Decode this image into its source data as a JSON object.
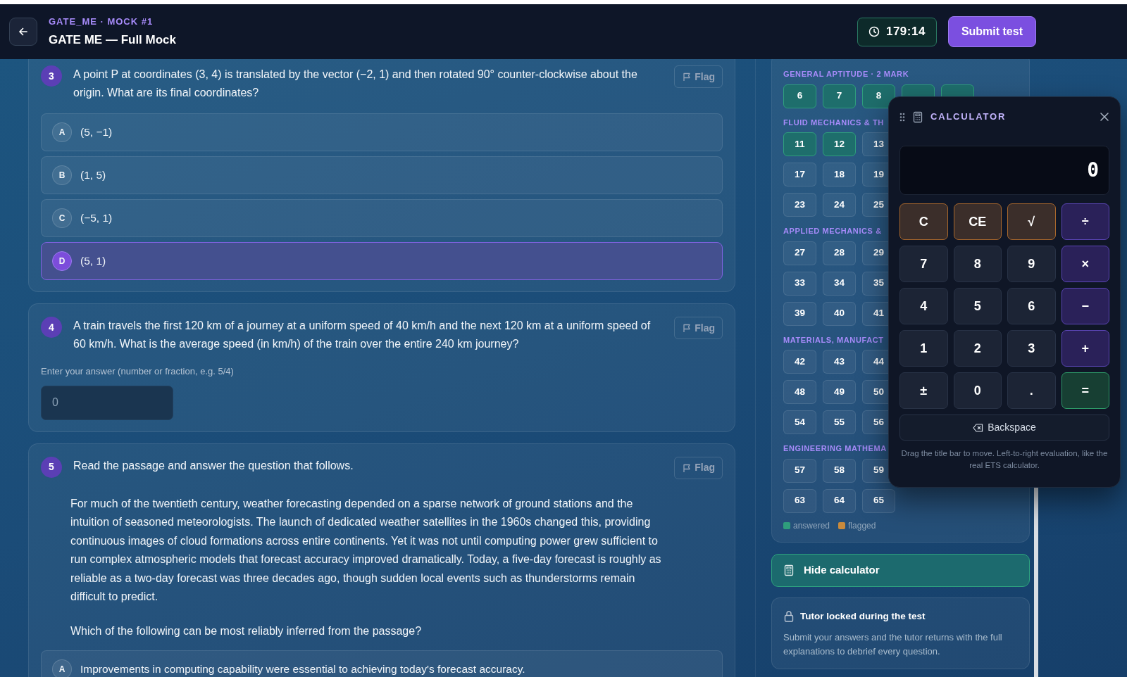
{
  "header": {
    "eyebrow": "GATE_ME · MOCK #1",
    "title": "GATE ME — Full Mock",
    "timer": "179:14",
    "submit": "Submit test"
  },
  "questions": [
    {
      "number": "3",
      "kind": "mcq",
      "prompt": "A point P at coordinates (3, 4) is translated by the vector (−2, 1) and then rotated 90° counter-clockwise about the origin. What are its final coordinates?",
      "flag": "Flag",
      "options": [
        {
          "letter": "A",
          "text": "(5, −1)",
          "selected": false
        },
        {
          "letter": "B",
          "text": "(1, 5)",
          "selected": false
        },
        {
          "letter": "C",
          "text": "(−5, 1)",
          "selected": false
        },
        {
          "letter": "D",
          "text": "(5, 1)",
          "selected": true
        }
      ]
    },
    {
      "number": "4",
      "kind": "numeric",
      "prompt": "A train travels the first 120 km of a journey at a uniform speed of 40 km/h and the next 120 km at a uniform speed of 60 km/h. What is the average speed (in km/h) of the train over the entire 240 km journey?",
      "flag": "Flag",
      "answer_label": "Enter your answer (number or fraction, e.g. 5/4)",
      "placeholder": "0"
    },
    {
      "number": "5",
      "kind": "passage",
      "prompt": "Read the passage and answer the question that follows.",
      "flag": "Flag",
      "passage": "For much of the twentieth century, weather forecasting depended on a sparse network of ground stations and the intuition of seasoned meteorologists. The launch of dedicated weather satellites in the 1960s changed this, providing continuous images of cloud formations across entire continents. Yet it was not until computing power grew sufficient to run complex atmospheric models that forecast accuracy improved dramatically. Today, a five-day forecast is roughly as reliable as a two-day forecast was three decades ago, though sudden local events such as thunderstorms remain difficult to predict.",
      "question": "Which of the following can be most reliably inferred from the passage?",
      "options": [
        {
          "letter": "A",
          "text": "Improvements in computing capability were essential to achieving today's forecast accuracy.",
          "selected": false
        }
      ]
    }
  ],
  "palette": {
    "sections": [
      {
        "title": "GENERAL APTITUDE · 2 MARK",
        "rows": [
          [
            {
              "label": "6",
              "answered": true
            },
            {
              "label": "7",
              "answered": true
            },
            {
              "label": "8",
              "answered": true
            },
            {
              "answered": true
            },
            {
              "answered": true
            }
          ]
        ]
      },
      {
        "title": "FLUID MECHANICS & TH",
        "rows": [
          [
            {
              "label": "11",
              "answered": true
            },
            {
              "label": "12",
              "answered": true
            },
            {
              "label": "13",
              "answered": false
            }
          ],
          [
            {
              "label": "17",
              "answered": false
            },
            {
              "label": "18",
              "answered": false
            },
            {
              "label": "19",
              "answered": false
            }
          ],
          [
            {
              "label": "23",
              "answered": false
            },
            {
              "label": "24",
              "answered": false
            },
            {
              "label": "25",
              "answered": false
            }
          ]
        ]
      },
      {
        "title": "APPLIED MECHANICS &",
        "rows": [
          [
            {
              "label": "27",
              "answered": false
            },
            {
              "label": "28",
              "answered": false
            },
            {
              "label": "29",
              "answered": false
            }
          ],
          [
            {
              "label": "33",
              "answered": false
            },
            {
              "label": "34",
              "answered": false
            },
            {
              "label": "35",
              "answered": false
            }
          ],
          [
            {
              "label": "39",
              "answered": false
            },
            {
              "label": "40",
              "answered": false
            },
            {
              "label": "41",
              "answered": false
            }
          ]
        ]
      },
      {
        "title": "MATERIALS, MANUFACT",
        "rows": [
          [
            {
              "label": "42",
              "answered": false
            },
            {
              "label": "43",
              "answered": false
            },
            {
              "label": "44",
              "answered": false
            }
          ],
          [
            {
              "label": "48",
              "answered": false
            },
            {
              "label": "49",
              "answered": false
            },
            {
              "label": "50",
              "answered": false
            }
          ],
          [
            {
              "label": "54",
              "answered": false
            },
            {
              "label": "55",
              "answered": false
            },
            {
              "label": "56",
              "answered": false
            }
          ]
        ]
      },
      {
        "title": "ENGINEERING MATHEMA",
        "rows": [
          [
            {
              "label": "57",
              "answered": false
            },
            {
              "label": "58",
              "answered": false
            },
            {
              "label": "59",
              "answered": false
            }
          ],
          [
            {
              "label": "63",
              "answered": false
            },
            {
              "label": "64",
              "answered": false
            },
            {
              "label": "65",
              "answered": false
            }
          ]
        ]
      }
    ],
    "legend": [
      {
        "label": "answered",
        "color": "#2f9e7c"
      },
      {
        "label": "flagged",
        "color": "#c98a3c"
      }
    ]
  },
  "calculator_toggle": "Hide calculator",
  "tutor": {
    "title": "Tutor locked during the test",
    "text": "Submit your answers and the tutor returns with the full explanations to debrief every question."
  },
  "calculator": {
    "title": "CALCULATOR",
    "display": "0",
    "keys": [
      {
        "label": "C",
        "kind": "fn"
      },
      {
        "label": "CE",
        "kind": "fn"
      },
      {
        "label": "√",
        "kind": "fn"
      },
      {
        "label": "÷",
        "kind": "op"
      },
      {
        "label": "7",
        "kind": "num"
      },
      {
        "label": "8",
        "kind": "num"
      },
      {
        "label": "9",
        "kind": "num"
      },
      {
        "label": "×",
        "kind": "op"
      },
      {
        "label": "4",
        "kind": "num"
      },
      {
        "label": "5",
        "kind": "num"
      },
      {
        "label": "6",
        "kind": "num"
      },
      {
        "label": "−",
        "kind": "op"
      },
      {
        "label": "1",
        "kind": "num"
      },
      {
        "label": "2",
        "kind": "num"
      },
      {
        "label": "3",
        "kind": "num"
      },
      {
        "label": "+",
        "kind": "op"
      },
      {
        "label": "±",
        "kind": "num"
      },
      {
        "label": "0",
        "kind": "num"
      },
      {
        "label": ".",
        "kind": "num"
      },
      {
        "label": "=",
        "kind": "eq"
      }
    ],
    "backspace": "Backspace",
    "note": "Drag the title bar to move. Left-to-right evaluation, like the real ETS calculator."
  }
}
